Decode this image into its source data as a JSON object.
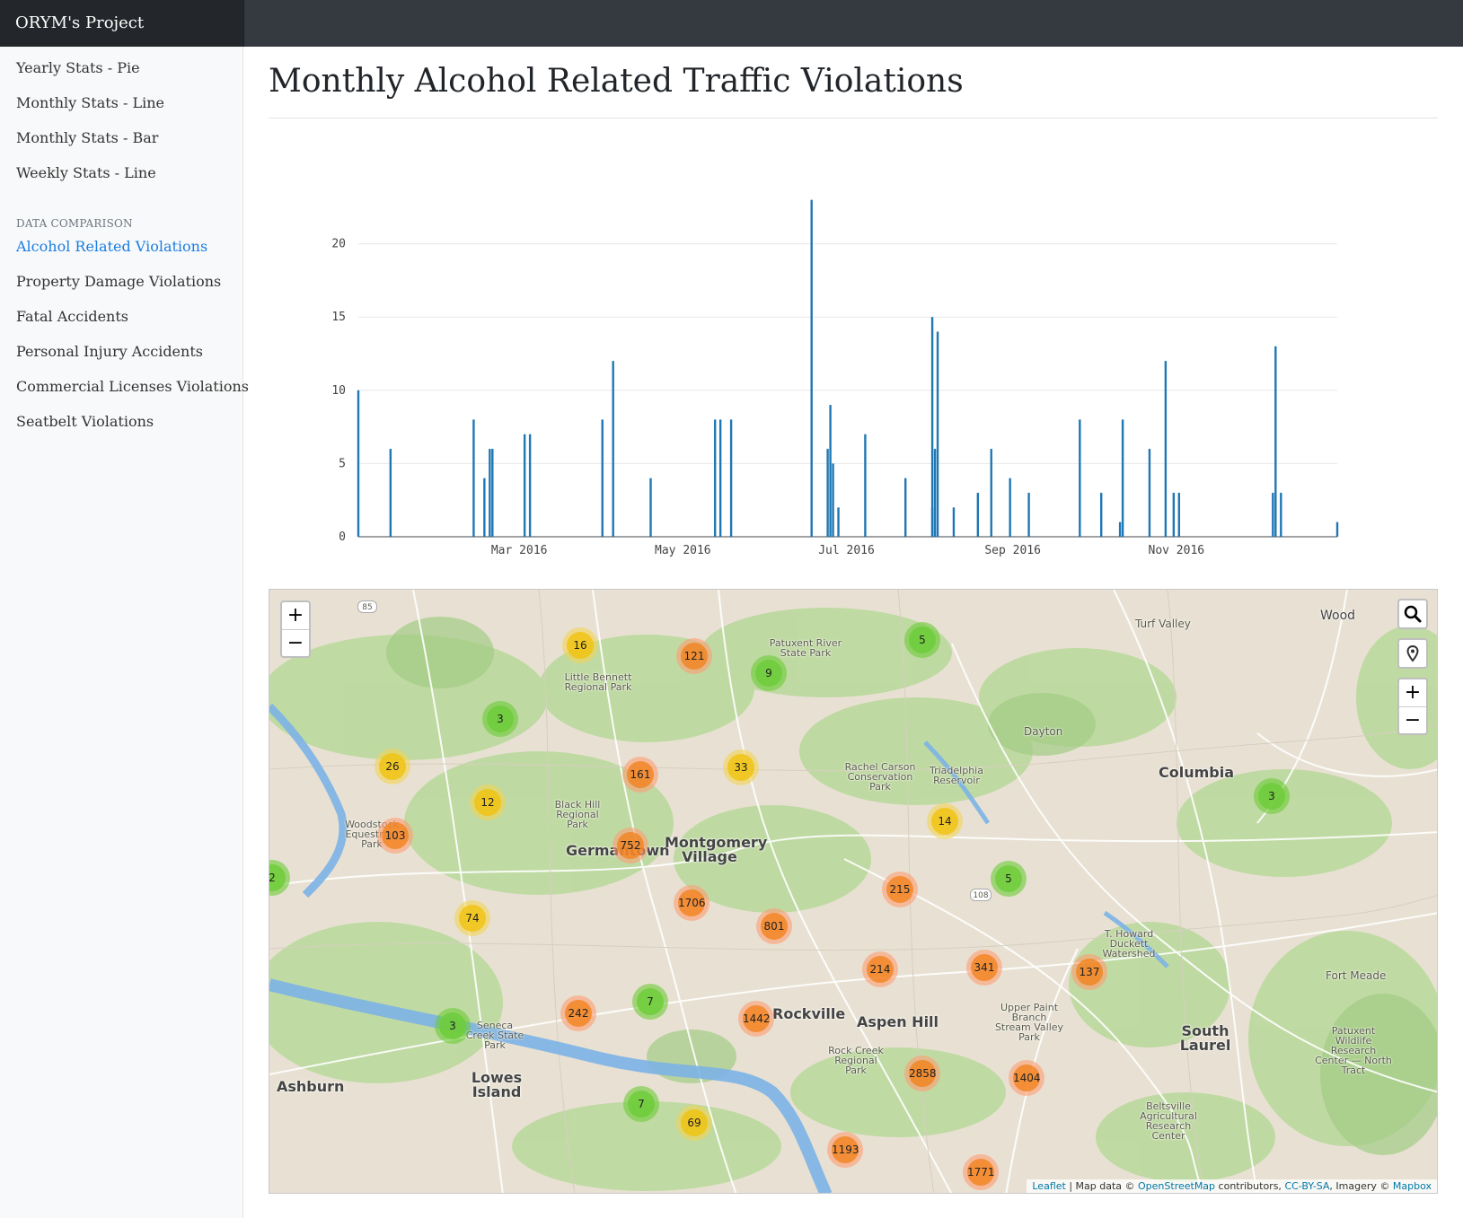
{
  "app": {
    "brand": "ORYM's Project"
  },
  "sidebar": {
    "items": [
      {
        "label": "Yearly Stats - Pie"
      },
      {
        "label": "Monthly Stats - Line"
      },
      {
        "label": "Monthly Stats - Bar"
      },
      {
        "label": "Weekly Stats - Line"
      }
    ],
    "section_heading": "DATA COMPARISON",
    "comparison_items": [
      {
        "label": "Alcohol Related Violations",
        "active": true
      },
      {
        "label": "Property Damage Violations"
      },
      {
        "label": "Fatal Accidents"
      },
      {
        "label": "Personal Injury Accidents"
      },
      {
        "label": "Commercial Licenses Violations"
      },
      {
        "label": "Seatbelt Violations"
      }
    ]
  },
  "main": {
    "title": "Monthly Alcohol Related Traffic Violations"
  },
  "colors": {
    "bar": "#1f77b4",
    "accent": "#1a7de0",
    "topbar": "#343a40"
  },
  "chart_data": {
    "type": "bar",
    "title": "",
    "xlabel": "",
    "ylabel": "",
    "x_range": [
      "2016-01-01",
      "2016-12-31"
    ],
    "ylim": [
      0,
      25
    ],
    "y_ticks": [
      0,
      5,
      10,
      15,
      20
    ],
    "x_ticks": [
      {
        "date": "2016-03-01",
        "label": "Mar 2016"
      },
      {
        "date": "2016-05-01",
        "label": "May 2016"
      },
      {
        "date": "2016-07-01",
        "label": "Jul 2016"
      },
      {
        "date": "2016-09-01",
        "label": "Sep 2016"
      },
      {
        "date": "2016-11-01",
        "label": "Nov 2016"
      }
    ],
    "grid": true,
    "x": [
      "2016-01-01",
      "2016-01-13",
      "2016-02-13",
      "2016-02-17",
      "2016-02-19",
      "2016-02-20",
      "2016-03-03",
      "2016-03-05",
      "2016-04-01",
      "2016-04-05",
      "2016-04-19",
      "2016-05-13",
      "2016-05-15",
      "2016-05-19",
      "2016-06-18",
      "2016-06-24",
      "2016-06-25",
      "2016-06-26",
      "2016-06-28",
      "2016-07-08",
      "2016-07-23",
      "2016-08-02",
      "2016-08-02",
      "2016-08-03",
      "2016-08-04",
      "2016-08-10",
      "2016-08-19",
      "2016-08-24",
      "2016-08-31",
      "2016-09-07",
      "2016-09-26",
      "2016-10-04",
      "2016-10-11",
      "2016-10-12",
      "2016-10-22",
      "2016-10-28",
      "2016-10-31",
      "2016-11-02",
      "2016-12-07",
      "2016-12-08",
      "2016-12-10",
      "2016-12-31"
    ],
    "values": [
      10,
      6,
      8,
      4,
      6,
      6,
      7,
      7,
      8,
      12,
      4,
      8,
      8,
      8,
      23,
      6,
      9,
      5,
      2,
      7,
      4,
      15,
      2,
      6,
      14,
      2,
      3,
      6,
      4,
      3,
      8,
      3,
      1,
      8,
      6,
      12,
      3,
      3,
      3,
      13,
      3,
      1
    ]
  },
  "map": {
    "zoom_in": "+",
    "zoom_out": "−",
    "search_icon": "search-icon",
    "locate_icon": "marker-icon",
    "places": [
      {
        "name": "Germantown"
      },
      {
        "name": "Montgomery Village"
      },
      {
        "name": "Columbia"
      },
      {
        "name": "Aspen Hill"
      },
      {
        "name": "South Laurel"
      },
      {
        "name": "Lowes Island"
      },
      {
        "name": "Ashburn"
      },
      {
        "name": "Rockville"
      },
      {
        "name": "Dayton"
      },
      {
        "name": "Turf Valley"
      },
      {
        "name": "Fort Meade"
      },
      {
        "name": "Wood"
      },
      {
        "name": "Little Bennett Regional Park"
      },
      {
        "name": "Patuxent River State Park"
      },
      {
        "name": "Rachel Carson Conservation Park"
      },
      {
        "name": "Triadelphia Reservoir"
      },
      {
        "name": "Black Hill Regional Park"
      },
      {
        "name": "Seneca Creek State Park"
      },
      {
        "name": "Rock Creek Regional Park"
      },
      {
        "name": "Upper Paint Branch Stream Valley Park"
      },
      {
        "name": "T. Howard Duckett Watershed"
      },
      {
        "name": "Beltsville Agricultural Research Center"
      },
      {
        "name": "Patuxent Wildlife Research Center — North Tract"
      },
      {
        "name": "Woodstock Equestrian Park"
      }
    ],
    "road_shields": [
      "85",
      "108"
    ],
    "clusters": [
      {
        "count": "16",
        "size": "medium"
      },
      {
        "count": "121",
        "size": "large"
      },
      {
        "count": "9",
        "size": "small"
      },
      {
        "count": "5",
        "size": "small"
      },
      {
        "count": "3",
        "size": "small"
      },
      {
        "count": "26",
        "size": "medium"
      },
      {
        "count": "161",
        "size": "large"
      },
      {
        "count": "33",
        "size": "medium"
      },
      {
        "count": "12",
        "size": "medium"
      },
      {
        "count": "103",
        "size": "large"
      },
      {
        "count": "14",
        "size": "medium"
      },
      {
        "count": "3",
        "size": "small"
      },
      {
        "count": "752",
        "size": "large"
      },
      {
        "count": "2",
        "size": "small"
      },
      {
        "count": "5",
        "size": "small"
      },
      {
        "count": "1706",
        "size": "large"
      },
      {
        "count": "215",
        "size": "large"
      },
      {
        "count": "74",
        "size": "medium"
      },
      {
        "count": "801",
        "size": "large"
      },
      {
        "count": "214",
        "size": "large"
      },
      {
        "count": "341",
        "size": "large"
      },
      {
        "count": "137",
        "size": "large"
      },
      {
        "count": "7",
        "size": "small"
      },
      {
        "count": "242",
        "size": "large"
      },
      {
        "count": "1442",
        "size": "large"
      },
      {
        "count": "3",
        "size": "small"
      },
      {
        "count": "2858",
        "size": "large"
      },
      {
        "count": "1404",
        "size": "large"
      },
      {
        "count": "7",
        "size": "small"
      },
      {
        "count": "69",
        "size": "medium"
      },
      {
        "count": "1193",
        "size": "large"
      },
      {
        "count": "1771",
        "size": "large"
      }
    ],
    "attribution": {
      "leaflet": "Leaflet",
      "sep1": " | Map data © ",
      "osm": "OpenStreetMap",
      "contrib": " contributors, ",
      "license": "CC-BY-SA",
      "imagery": ", Imagery © ",
      "mapbox": "Mapbox"
    }
  }
}
